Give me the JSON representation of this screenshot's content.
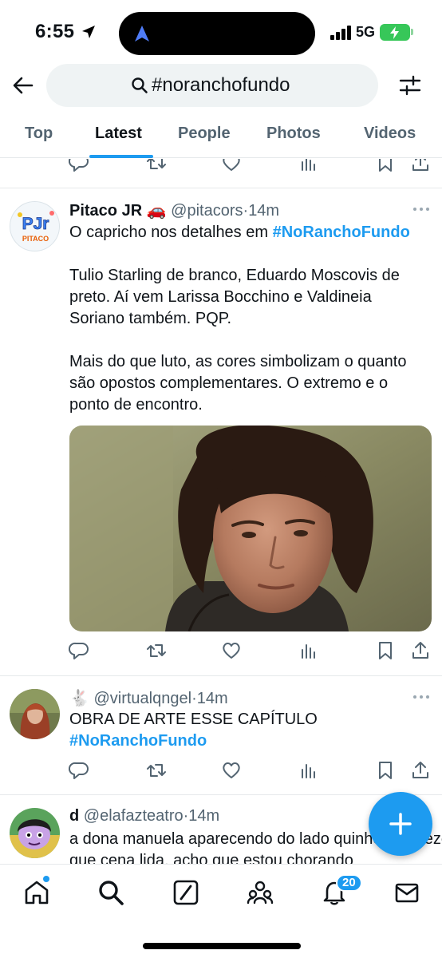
{
  "status_bar": {
    "time": "6:55",
    "network": "5G"
  },
  "search": {
    "query": "#noranchofundo"
  },
  "tabs": [
    {
      "label": "Top"
    },
    {
      "label": "Latest"
    },
    {
      "label": "People"
    },
    {
      "label": "Photos"
    },
    {
      "label": "Videos"
    }
  ],
  "active_tab": "Latest",
  "tweets": [
    {
      "display_name": "Pitaco JR 🚗",
      "handle": "@pitacors",
      "time": "14m",
      "avatar_text": "PITACO",
      "lines": [
        {
          "text": "O capricho nos detalhes em ",
          "hashtag": "#NoRanchoFundo"
        },
        {
          "text": ""
        },
        {
          "text": "Tulio Starling de branco, Eduardo Moscovis de"
        },
        {
          "text": "preto. Aí vem Larissa Bocchino e Valdineia"
        },
        {
          "text": "Soriano também. PQP."
        },
        {
          "text": ""
        },
        {
          "text": "Mais do que luto, as cores simbolizam o quanto"
        },
        {
          "text": "são opostos complementares. O extremo e o"
        },
        {
          "text": "ponto de encontro."
        }
      ]
    },
    {
      "display_name": "🐇",
      "handle": "@virtualqngel",
      "time": "14m",
      "lines": [
        {
          "text": "OBRA DE ARTE ESSE CAPÍTULO"
        },
        {
          "text": "",
          "hashtag": "#NoRanchoFundo"
        }
      ]
    },
    {
      "display_name": "d",
      "handle": "@elafazteatro",
      "time": "14m",
      "lines": [
        {
          "text": "a dona manuela aparecendo do lado quinhentas vezes"
        },
        {
          "text": "que cena lida, acho que estou chorando"
        }
      ]
    }
  ],
  "notifications_badge": "20",
  "colors": {
    "accent": "#1d9bf0",
    "text": "#0f1419",
    "secondary": "#536471"
  },
  "icons": [
    "back-arrow-icon",
    "search-icon",
    "filter-icon",
    "reply-icon",
    "retweet-icon",
    "like-icon",
    "views-icon",
    "bookmark-icon",
    "share-icon",
    "home-icon",
    "explore-icon",
    "grok-icon",
    "communities-icon",
    "bell-icon",
    "mail-icon",
    "compose-plus-icon"
  ]
}
